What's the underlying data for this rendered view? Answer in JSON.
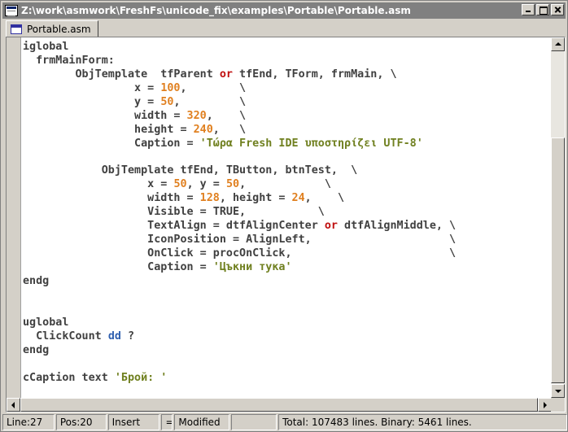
{
  "window": {
    "title": "Z:\\work\\asmwork\\FreshFs\\unicode_fix\\examples\\Portable\\Portable.asm"
  },
  "tabs": [
    {
      "label": "Portable.asm",
      "icon": "document-window-icon"
    }
  ],
  "editor": {
    "lines": [
      [
        {
          "t": "iglobal"
        }
      ],
      [
        {
          "t": "  frmMainForm:"
        }
      ],
      [
        {
          "t": "        ObjTemplate  tfParent "
        },
        {
          "t": "or",
          "c": "kw"
        },
        {
          "t": " tfEnd, TForm, frmMain, \\"
        }
      ],
      [
        {
          "t": "                 x = "
        },
        {
          "t": "100",
          "c": "num"
        },
        {
          "t": ",        \\"
        }
      ],
      [
        {
          "t": "                 y = "
        },
        {
          "t": "50",
          "c": "num"
        },
        {
          "t": ",         \\"
        }
      ],
      [
        {
          "t": "                 width = "
        },
        {
          "t": "320",
          "c": "num"
        },
        {
          "t": ",    \\"
        }
      ],
      [
        {
          "t": "                 height = "
        },
        {
          "t": "240",
          "c": "num"
        },
        {
          "t": ",   \\"
        }
      ],
      [
        {
          "t": "                 Caption = "
        },
        {
          "t": "'Τώρα Fresh IDE υποστηρίζει UTF-8'",
          "c": "str"
        }
      ],
      [
        {
          "t": ""
        }
      ],
      [
        {
          "t": "            ObjTemplate tfEnd, TButton, btnTest,  \\"
        }
      ],
      [
        {
          "t": "                   x = "
        },
        {
          "t": "50",
          "c": "num"
        },
        {
          "t": ", y = "
        },
        {
          "t": "50",
          "c": "num"
        },
        {
          "t": ",            \\"
        }
      ],
      [
        {
          "t": "                   width = "
        },
        {
          "t": "128",
          "c": "num"
        },
        {
          "t": ", height = "
        },
        {
          "t": "24",
          "c": "num"
        },
        {
          "t": ",    \\"
        }
      ],
      [
        {
          "t": "                   Visible = TRUE,           \\"
        }
      ],
      [
        {
          "t": "                   TextAlign = dtfAlignCenter "
        },
        {
          "t": "or",
          "c": "kw"
        },
        {
          "t": " dtfAlignMiddle, \\"
        }
      ],
      [
        {
          "t": "                   IconPosition = AlignLeft,                     \\"
        }
      ],
      [
        {
          "t": "                   OnClick = procOnClick,                        \\"
        }
      ],
      [
        {
          "t": "                   Caption = "
        },
        {
          "t": "'Цъкни тука'",
          "c": "str"
        }
      ],
      [
        {
          "t": "endg"
        }
      ],
      [
        {
          "t": ""
        }
      ],
      [
        {
          "t": ""
        }
      ],
      [
        {
          "t": "uglobal"
        }
      ],
      [
        {
          "t": "  ClickCount "
        },
        {
          "t": "dd",
          "c": "typ"
        },
        {
          "t": " ?"
        }
      ],
      [
        {
          "t": "endg"
        }
      ],
      [
        {
          "t": ""
        }
      ],
      [
        {
          "t": "cCaption text "
        },
        {
          "t": "'Брой: '",
          "c": "str"
        }
      ]
    ]
  },
  "statusbar": {
    "line": "Line:27",
    "pos": "Pos:20",
    "mode": "Insert",
    "eq": "=",
    "modified": "Modified",
    "empty": "",
    "total": "Total: 107483 lines.   Binary: 5461 lines."
  }
}
